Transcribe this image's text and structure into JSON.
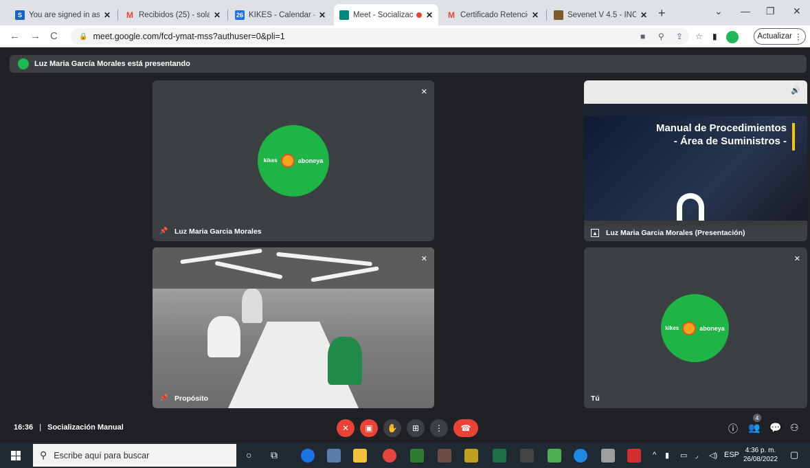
{
  "browser": {
    "tabs": [
      {
        "title": "You are signed in as S",
        "fav": "S",
        "color": "#1565c0"
      },
      {
        "title": "Recibidos (25) - solan",
        "fav": "M",
        "color": "#ea4335"
      },
      {
        "title": "KIKES - Calendar - De",
        "fav": "26",
        "color": "#1a73e8"
      },
      {
        "title": "Meet - Socializaci",
        "fav": "",
        "color": "#00897b",
        "active": true
      },
      {
        "title": "Certificado Retención",
        "fav": "M",
        "color": "#ea4335"
      },
      {
        "title": "Sevenet V 4.5 - INCUE",
        "fav": "",
        "color": "#7b5a2b"
      }
    ],
    "url": "meet.google.com/fcd-ymat-mss?authuser=0&pli=1",
    "update_label": "Actualizar"
  },
  "meet": {
    "banner": "Luz Maria García Morales está presentando",
    "tiles": {
      "luz": "Luz Maria Garcia Morales",
      "presentation": "Luz Maria Garcia Morales (Presentación)",
      "proposito": "Propósito",
      "you": "Tú"
    },
    "slide_title_1": "Manual de Procedimientos",
    "slide_title_2": "- Área de Suministros -",
    "logo": {
      "brand_left": "kikes",
      "brand_right": "aboneya"
    },
    "time": "16:36",
    "separator": "|",
    "meeting_name": "Socialización Manual",
    "participants_count": "4"
  },
  "taskbar": {
    "search_placeholder": "Escribe aquí para buscar",
    "lang": "ESP",
    "time": "4:36 p. m.",
    "date": "26/08/2022"
  }
}
